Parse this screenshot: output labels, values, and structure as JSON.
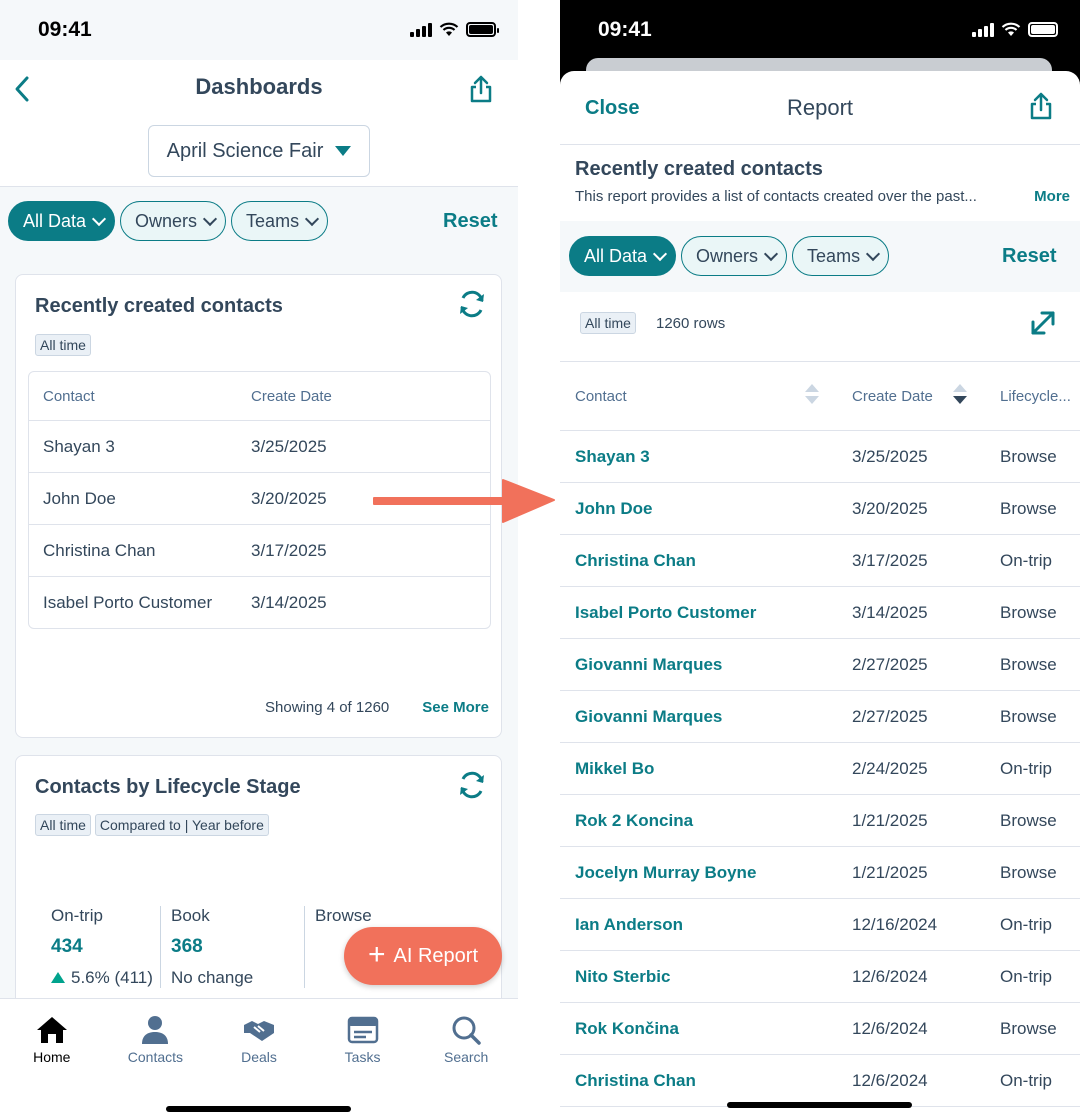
{
  "left": {
    "status_time": "09:41",
    "title": "Dashboards",
    "dashboard_select": "April Science Fair",
    "filters": [
      "All Data",
      "Owners",
      "Teams"
    ],
    "reset": "Reset",
    "card1": {
      "title": "Recently created contacts",
      "tag": "All time",
      "headers": [
        "Contact",
        "Create Date"
      ],
      "rows": [
        {
          "contact": "Shayan 3",
          "date": "3/25/2025"
        },
        {
          "contact": "John Doe",
          "date": "3/20/2025"
        },
        {
          "contact": "Christina Chan",
          "date": "3/17/2025"
        },
        {
          "contact": "Isabel Porto Customer",
          "date": "3/14/2025"
        }
      ],
      "showing": "Showing 4 of 1260",
      "see_more": "See More"
    },
    "card2": {
      "title": "Contacts by Lifecycle Stage",
      "tags": [
        "All time",
        "Compared to | Year before"
      ],
      "stats": [
        {
          "label": "On-trip",
          "value": "434",
          "change": "5.6% (411)"
        },
        {
          "label": "Book",
          "value": "368",
          "change": "No change"
        },
        {
          "label": "Browse",
          "value": "",
          "change": ""
        }
      ]
    },
    "ai_button": "AI Report",
    "tabs": [
      {
        "label": "Home",
        "icon": "home-icon"
      },
      {
        "label": "Contacts",
        "icon": "person-icon"
      },
      {
        "label": "Deals",
        "icon": "handshake-icon"
      },
      {
        "label": "Tasks",
        "icon": "tasks-icon"
      },
      {
        "label": "Search",
        "icon": "search-icon"
      }
    ]
  },
  "right": {
    "status_time": "09:41",
    "close": "Close",
    "title": "Report",
    "report_title": "Recently created contacts",
    "description": "This report provides a list of contacts created over the past...",
    "more": "More",
    "filters": [
      "All Data",
      "Owners",
      "Teams"
    ],
    "reset": "Reset",
    "tag": "All time",
    "rows_count": "1260 rows",
    "headers": [
      "Contact",
      "Create Date",
      "Lifecycle..."
    ],
    "rows": [
      {
        "contact": "Shayan 3",
        "date": "3/25/2025",
        "stage": "Browse"
      },
      {
        "contact": "John Doe",
        "date": "3/20/2025",
        "stage": "Browse"
      },
      {
        "contact": "Christina Chan",
        "date": "3/17/2025",
        "stage": "On-trip"
      },
      {
        "contact": "Isabel Porto Customer",
        "date": "3/14/2025",
        "stage": "Browse"
      },
      {
        "contact": "Giovanni Marques",
        "date": "2/27/2025",
        "stage": "Browse"
      },
      {
        "contact": "Giovanni Marques",
        "date": "2/27/2025",
        "stage": "Browse"
      },
      {
        "contact": "Mikkel Bo",
        "date": "2/24/2025",
        "stage": "On-trip"
      },
      {
        "contact": "Rok 2 Koncina",
        "date": "1/21/2025",
        "stage": "Browse"
      },
      {
        "contact": "Jocelyn Murray Boyne",
        "date": "1/21/2025",
        "stage": "Browse"
      },
      {
        "contact": "Ian Anderson",
        "date": "12/16/2024",
        "stage": "On-trip"
      },
      {
        "contact": "Nito Sterbic",
        "date": "12/6/2024",
        "stage": "On-trip"
      },
      {
        "contact": "Rok Končina",
        "date": "12/6/2024",
        "stage": "Browse"
      },
      {
        "contact": "Christina Chan",
        "date": "12/6/2024",
        "stage": "On-trip"
      }
    ]
  },
  "colors": {
    "accent": "#0b7c86",
    "ai_button": "#f1715b",
    "arrow": "#f1715b",
    "positive": "#00a38d"
  }
}
